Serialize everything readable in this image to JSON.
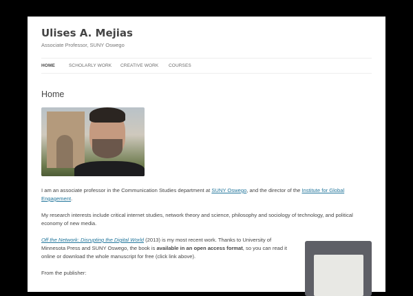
{
  "site": {
    "title": "Ulises A. Mejias",
    "tagline": "Associate Professor, SUNY Oswego"
  },
  "nav": [
    "HOME",
    "SCHOLARLY WORK",
    "CREATIVE WORK",
    "COURSES"
  ],
  "page_title": "Home",
  "p1": {
    "a": "I am an associate professor in the Communication Studies department at ",
    "link1": "SUNY Oswego",
    "b": ", and the director of the ",
    "link2": "Institute for Global Engagement",
    "c": "."
  },
  "p2": "My research interests include critical internet studies, network theory and science, philosophy and sociology of technology, and political economy of new media.",
  "p3": {
    "link": "Off the Network: Disrupting the Digital World",
    "a": " (2013) is my most recent work. Thanks to University of Minnesota Press and SUNY Oswego, the book is ",
    "bold": "available in an open access format",
    "b": ", so you can read it online or download the whole manuscript for free (click link above)."
  },
  "p4": "From the publisher:"
}
